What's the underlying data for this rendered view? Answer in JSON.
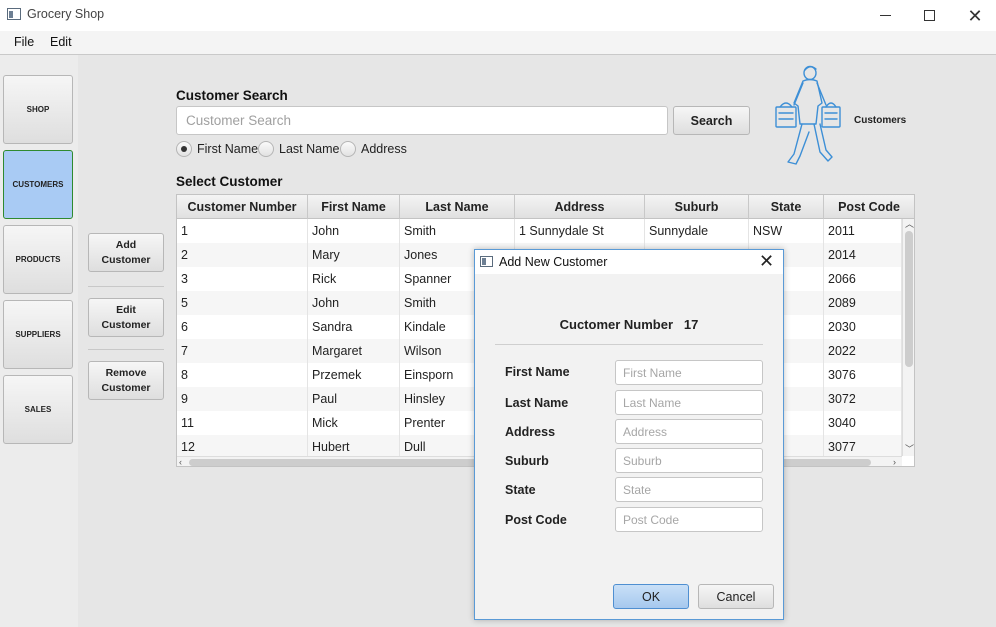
{
  "window": {
    "title": "Grocery Shop"
  },
  "menu": {
    "items": [
      "File",
      "Edit"
    ]
  },
  "nav": {
    "items": [
      "SHOP",
      "CUSTOMERS",
      "PRODUCTS",
      "SUPPLIERS",
      "SALES"
    ],
    "active": "CUSTOMERS"
  },
  "actions": {
    "add": "Add Customer",
    "edit": "Edit Customer",
    "remove": "Remove Customer"
  },
  "search": {
    "heading": "Customer Search",
    "placeholder": "Customer Search",
    "value": "",
    "button": "Search",
    "options": [
      "First Name",
      "Last Name",
      "Address"
    ],
    "selected": "First Name"
  },
  "illustration": {
    "icon": "shopper-with-bags-icon",
    "label": "Customers"
  },
  "table": {
    "heading": "Select Customer",
    "columns": [
      "Customer Number",
      "First Name",
      "Last Name",
      "Address",
      "Suburb",
      "State",
      "Post Code"
    ],
    "rows": [
      [
        "1",
        "John",
        "Smith",
        "1 Sunnydale St",
        "Sunnydale",
        "NSW",
        "2011"
      ],
      [
        "2",
        "Mary",
        "Jones",
        "",
        "",
        "",
        "2014"
      ],
      [
        "3",
        "Rick",
        "Spanner",
        "",
        "",
        "",
        "2066"
      ],
      [
        "5",
        "John",
        "Smith",
        "",
        "",
        "",
        "2089"
      ],
      [
        "6",
        "Sandra",
        "Kindale",
        "",
        "",
        "",
        "2030"
      ],
      [
        "7",
        "Margaret",
        "Wilson",
        "",
        "",
        "",
        "2022"
      ],
      [
        "8",
        "Przemek",
        "Einsporn",
        "",
        "",
        "",
        "3076"
      ],
      [
        "9",
        "Paul",
        "Hinsley",
        "",
        "",
        "",
        "3072"
      ],
      [
        "11",
        "Mick",
        "Prenter",
        "",
        "",
        "",
        "3040"
      ],
      [
        "12",
        "Hubert",
        "Dull",
        "",
        "",
        "",
        "3077"
      ]
    ]
  },
  "dialog": {
    "title": "Add New Customer",
    "number_label": "Cuctomer Number",
    "number_value": "17",
    "fields": [
      {
        "label": "First Name",
        "placeholder": "First Name",
        "value": ""
      },
      {
        "label": "Last Name",
        "placeholder": "Last Name",
        "value": ""
      },
      {
        "label": "Address",
        "placeholder": "Address",
        "value": ""
      },
      {
        "label": "Suburb",
        "placeholder": "Suburb",
        "value": ""
      },
      {
        "label": "State",
        "placeholder": "State",
        "value": ""
      },
      {
        "label": "Post Code",
        "placeholder": "Post Code",
        "value": ""
      }
    ],
    "ok": "OK",
    "cancel": "Cancel"
  },
  "colors": {
    "active_nav": "#a9cbf4",
    "dialog_border": "#5a9ad6",
    "ok_button": "#b8d6f3"
  }
}
